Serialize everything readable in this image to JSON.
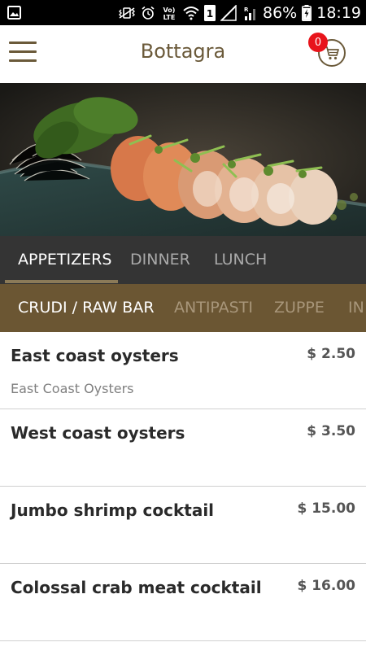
{
  "status_bar": {
    "battery_percent": "86%",
    "time": "18:19",
    "network_label": "LTE",
    "sim_label": "1"
  },
  "header": {
    "title": "Bottagra",
    "cart_count": "0"
  },
  "tabs_primary": [
    {
      "label": "APPETIZERS",
      "active": true
    },
    {
      "label": "DINNER",
      "active": false
    },
    {
      "label": "LUNCH",
      "active": false
    }
  ],
  "tabs_secondary": [
    {
      "label": "CRUDI / RAW BAR",
      "active": true
    },
    {
      "label": "ANTIPASTI",
      "active": false
    },
    {
      "label": "ZUPPE",
      "active": false
    },
    {
      "label": "IN",
      "active": false
    }
  ],
  "menu_items": [
    {
      "name": "East coast oysters",
      "price": "$ 2.50",
      "description": "East Coast Oysters"
    },
    {
      "name": "West coast oysters",
      "price": "$ 3.50",
      "description": ""
    },
    {
      "name": "Jumbo shrimp cocktail",
      "price": "$ 15.00",
      "description": ""
    },
    {
      "name": "Colossal crab meat cocktail",
      "price": "$ 16.00",
      "description": ""
    }
  ],
  "colors": {
    "brand_brown": "#6b5a3a",
    "secondary_tab_bg": "#6b5633",
    "primary_tab_bg": "#343434",
    "badge_red": "#e8141b"
  },
  "icons": {
    "status_left": "image-icon",
    "menu": "hamburger-menu-icon",
    "cart": "shopping-cart-icon"
  }
}
